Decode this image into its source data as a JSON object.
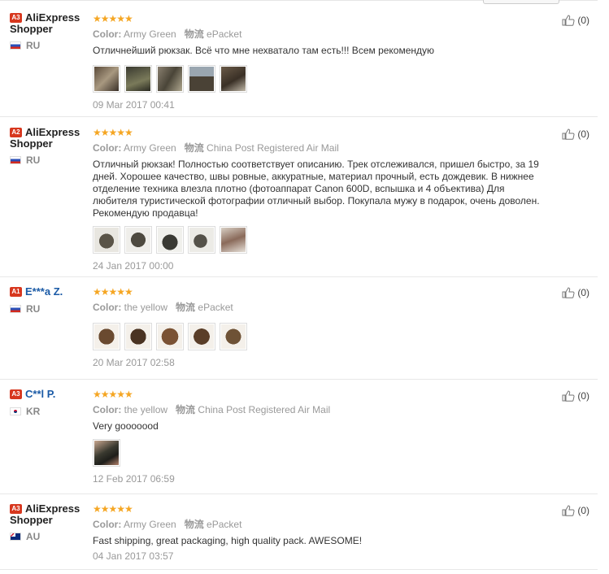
{
  "labels": {
    "color": "Color:",
    "shipping": "物流"
  },
  "reviews": [
    {
      "level": "A3",
      "name": "AliExpress Shopper",
      "country": "RU",
      "color": "Army Green",
      "shipping": "ePacket",
      "text": "Отличнейший рюкзак. Всё что мне нехватало там есть!!! Всем рекомендую",
      "photos": 5,
      "date": "09 Mar 2017 00:41",
      "useful": "(0)"
    },
    {
      "level": "A2",
      "name": "AliExpress Shopper",
      "country": "RU",
      "color": "Army Green",
      "shipping": "China Post Registered Air Mail",
      "text": "Отличный рюкзак! Полностью соответствует описанию. Трек отслеживался, пришел быстро, за 19 дней. Хорошее качество, швы ровные, аккуратные, материал прочный, есть дождевик. В нижнее отделение техника влезла плотно (фотоаппарат Canon 600D, вспышка и 4 объектива) Для любителя туристической фотографии отличный выбор. Покупала мужу в подарок, очень доволен. Рекомендую продавца!",
      "photos": 5,
      "date": "24 Jan 2017 00:00",
      "useful": "(0)"
    },
    {
      "level": "A1",
      "name": "E***a Z.",
      "country": "RU",
      "color": "the yellow",
      "shipping": "ePacket",
      "text": "",
      "photos": 5,
      "date": "20 Mar 2017 02:58",
      "useful": "(0)"
    },
    {
      "level": "A3",
      "name": "C**l P.",
      "country": "KR",
      "color": "the yellow",
      "shipping": "China Post Registered Air Mail",
      "text": "Very gooooood",
      "photos": 1,
      "date": "12 Feb 2017 06:59",
      "useful": "(0)"
    },
    {
      "level": "A3",
      "name": "AliExpress Shopper",
      "country": "AU",
      "color": "Army Green",
      "shipping": "ePacket",
      "text": "Fast shipping, great packaging, high quality pack. AWESOME!",
      "photos": 0,
      "date": "04 Jan 2017 03:57",
      "useful": "(0)"
    }
  ]
}
